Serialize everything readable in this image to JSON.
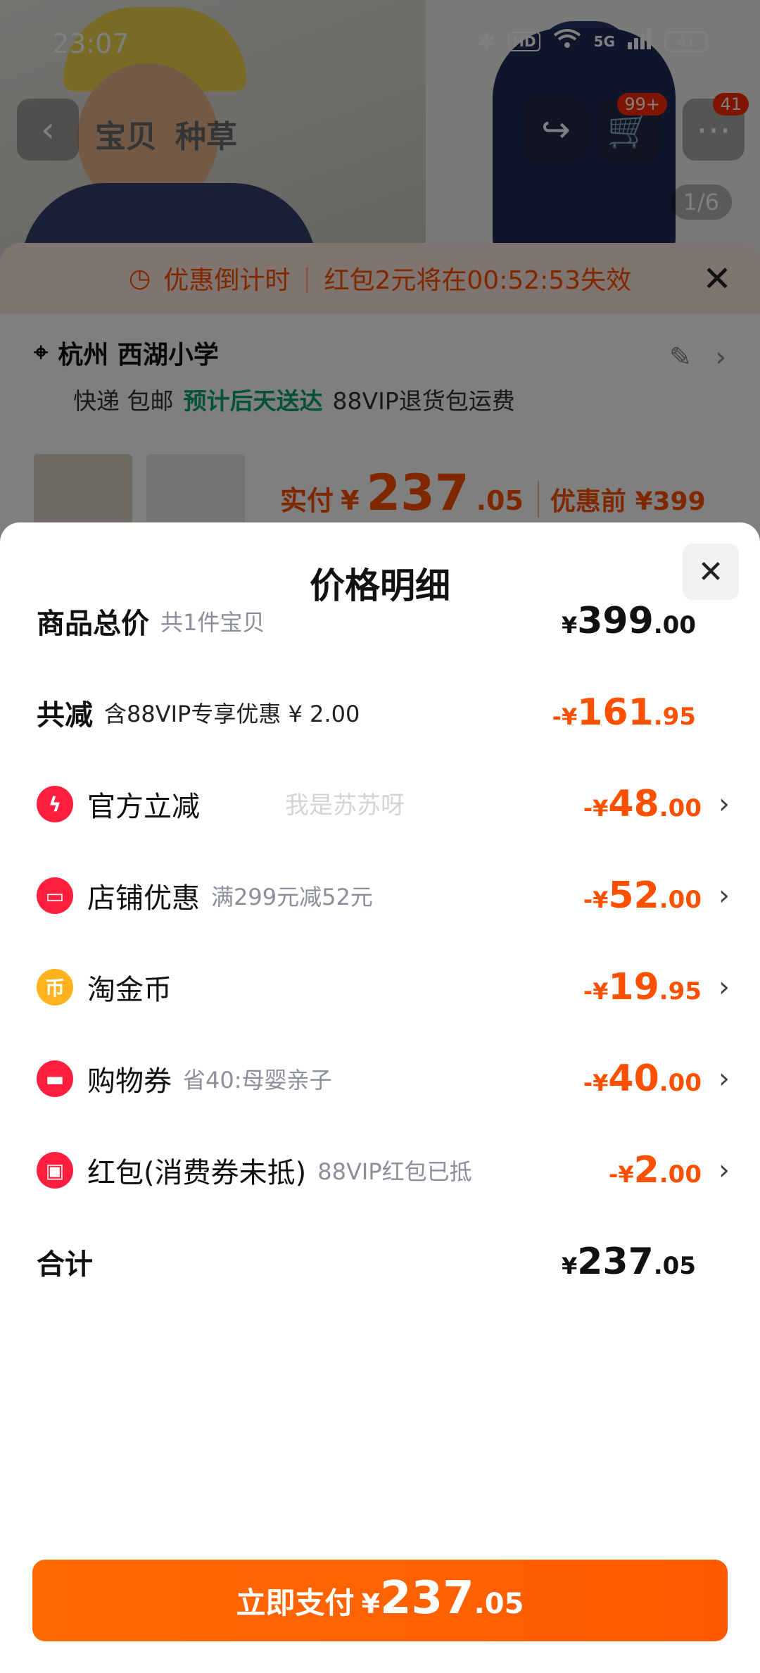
{
  "status_bar": {
    "time": "23:07",
    "bluetooth_icon": "✱",
    "hd": "HD",
    "network": "5G",
    "battery": "41"
  },
  "top_nav": {
    "tabs": [
      "宝贝",
      "种草"
    ],
    "cart_badge": "99+",
    "more_badge": "41",
    "image_counter": "1/6"
  },
  "background_sheet": {
    "countdown_label": "优惠倒计时",
    "countdown_text": "红包2元将在00:52:53失效",
    "address": "杭州 西湖小学",
    "delivery": "快递 包邮",
    "eta": "预计后天送达",
    "return_policy": "88VIP退货包运费",
    "paid_label": "实付",
    "paid_currency": "¥",
    "paid_int": "237",
    "paid_dec": ".05",
    "before_discount": "优惠前 ¥399"
  },
  "sheet": {
    "title": "价格明细",
    "watermark": "我是苏苏呀",
    "rows": {
      "total_price": {
        "label": "商品总价",
        "sub": "共1件宝贝",
        "sign": "¥",
        "int": "399",
        "dec": ".00"
      },
      "total_reduce": {
        "label": "共减",
        "sub": "含88VIP专享优惠 ¥ 2.00",
        "sign": "-¥",
        "int": "161",
        "dec": ".95"
      },
      "official": {
        "label": "官方立减",
        "sub": "",
        "sign": "-¥",
        "int": "48",
        "dec": ".00"
      },
      "store": {
        "label": "店铺优惠",
        "sub": "满299元减52元",
        "sign": "-¥",
        "int": "52",
        "dec": ".00"
      },
      "coins": {
        "label": "淘金币",
        "sub": "",
        "sign": "-¥",
        "int": "19",
        "dec": ".95"
      },
      "voucher": {
        "label": "购物券",
        "sub": "省40:母婴亲子",
        "sign": "-¥",
        "int": "40",
        "dec": ".00"
      },
      "red_packet": {
        "label": "红包(消费券未抵)",
        "sub": "88VIP红包已抵",
        "sign": "-¥",
        "int": "2",
        "dec": ".00"
      },
      "sum": {
        "label": "合计",
        "sign": "¥",
        "int": "237",
        "dec": ".05"
      }
    },
    "pay_button": {
      "label": "立即支付",
      "sign": "¥",
      "int": "237",
      "dec": ".05"
    }
  },
  "colors": {
    "accent_orange": "#ff5000",
    "icon_red": "#ff1f3c",
    "icon_gold": "#ffb21d",
    "eta_green": "#0aa36b"
  }
}
